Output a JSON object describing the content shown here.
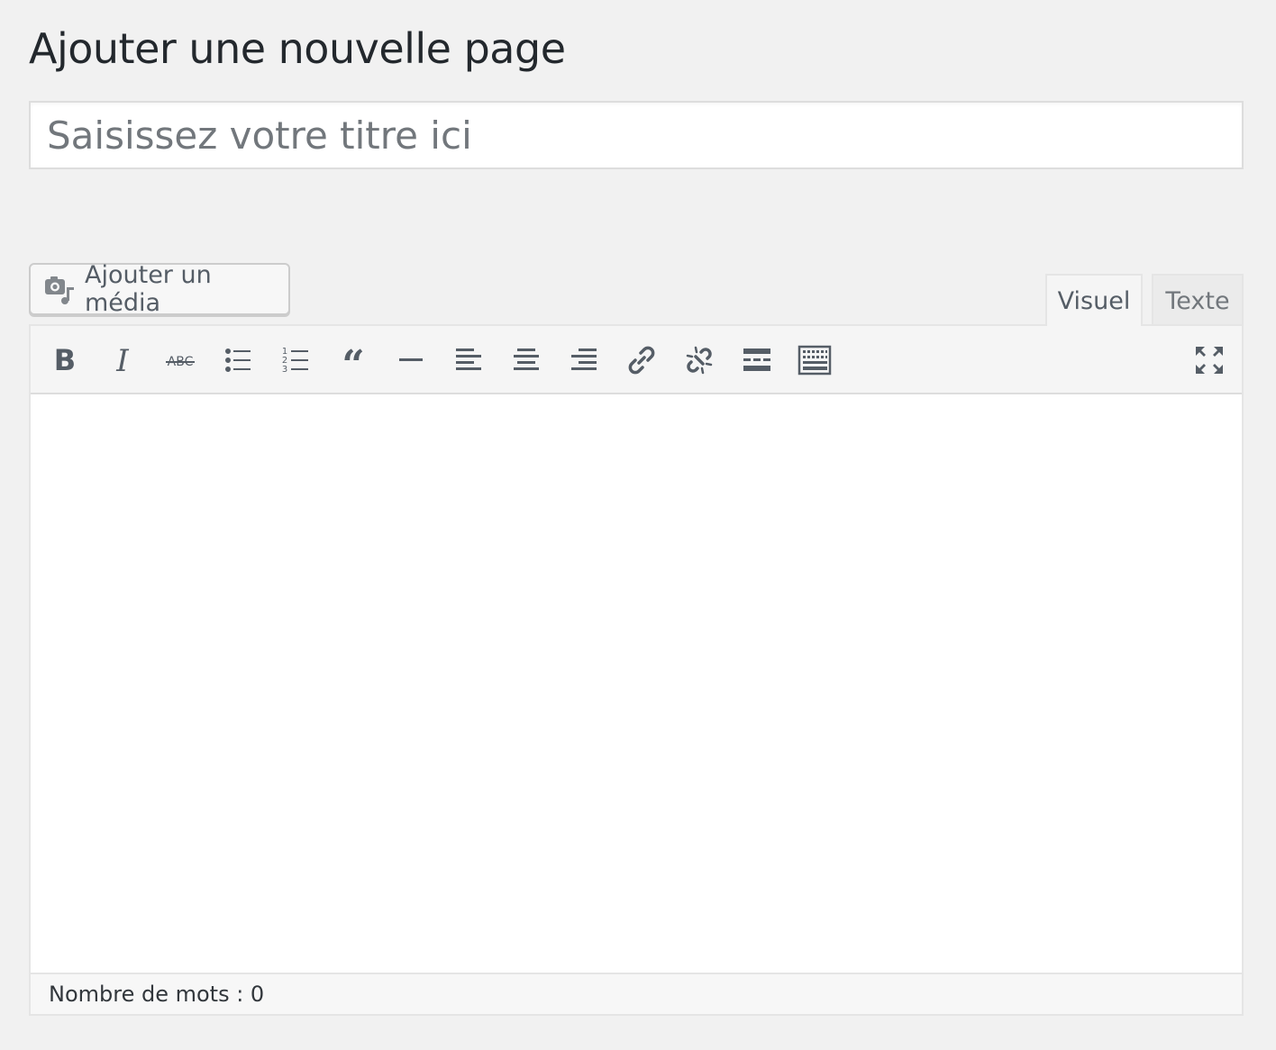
{
  "page": {
    "title": "Ajouter une nouvelle page"
  },
  "title_field": {
    "placeholder": "Saisissez votre titre ici",
    "value": ""
  },
  "media_button": {
    "label": "Ajouter un média",
    "icon": "add-media-icon"
  },
  "editor_tabs": [
    {
      "label": "Visuel",
      "active": true
    },
    {
      "label": "Texte",
      "active": false
    }
  ],
  "toolbar": {
    "buttons": [
      {
        "name": "bold",
        "icon": "bold-icon"
      },
      {
        "name": "italic",
        "icon": "italic-icon"
      },
      {
        "name": "strikethrough",
        "icon": "strikethrough-icon",
        "glyph_text": "ABC"
      },
      {
        "name": "bulleted-list",
        "icon": "bulleted-list-icon"
      },
      {
        "name": "numbered-list",
        "icon": "numbered-list-icon"
      },
      {
        "name": "blockquote",
        "icon": "blockquote-icon"
      },
      {
        "name": "horizontal-line",
        "icon": "horizontal-line-icon"
      },
      {
        "name": "align-left",
        "icon": "align-left-icon"
      },
      {
        "name": "align-center",
        "icon": "align-center-icon"
      },
      {
        "name": "align-right",
        "icon": "align-right-icon"
      },
      {
        "name": "insert-link",
        "icon": "link-icon"
      },
      {
        "name": "remove-link",
        "icon": "unlink-icon"
      },
      {
        "name": "read-more",
        "icon": "read-more-icon"
      },
      {
        "name": "toolbar-toggle",
        "icon": "keyboard-icon"
      },
      {
        "name": "fullscreen",
        "icon": "fullscreen-icon"
      }
    ]
  },
  "editor": {
    "content": ""
  },
  "status_bar": {
    "word_count": "Nombre de mots : 0"
  },
  "colors": {
    "background": "#f1f1f1",
    "icon": "#555d66",
    "text": "#23282d",
    "placeholder": "#72777c"
  }
}
